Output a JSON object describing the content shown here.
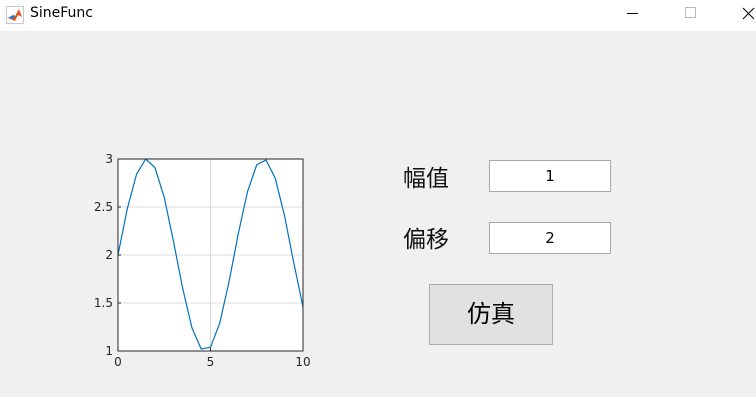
{
  "window": {
    "title": "SineFunc"
  },
  "controls": {
    "amplitude_label": "幅值",
    "amplitude_value": "1",
    "offset_label": "偏移",
    "offset_value": "2",
    "simulate_label": "仿真"
  },
  "colors": {
    "line": "#0072bd",
    "grid": "#dcdcdc",
    "axes": "#262626"
  },
  "chart_data": {
    "type": "line",
    "title": "",
    "xlabel": "",
    "ylabel": "",
    "xlim": [
      0,
      10
    ],
    "ylim": [
      1,
      3
    ],
    "xticks": [
      0,
      5,
      10
    ],
    "xtick_labels": [
      "0",
      "5",
      "10"
    ],
    "yticks": [
      1,
      1.5,
      2,
      2.5,
      3
    ],
    "ytick_labels": [
      "1",
      "1.5",
      "2",
      "2.5",
      "3"
    ],
    "grid": true,
    "legend": "none",
    "series": [
      {
        "x": [
          0,
          0.5,
          1,
          1.5,
          2,
          2.5,
          3,
          3.5,
          4,
          4.5,
          5,
          5.5,
          6,
          6.5,
          7,
          7.5,
          8,
          8.5,
          9,
          9.5,
          10
        ],
        "y": [
          2,
          2.48,
          2.84,
          3,
          2.91,
          2.6,
          2.14,
          1.65,
          1.24,
          1.02,
          1.04,
          1.29,
          1.72,
          2.22,
          2.66,
          2.94,
          2.99,
          2.8,
          2.41,
          1.92,
          1.46
        ]
      }
    ]
  }
}
